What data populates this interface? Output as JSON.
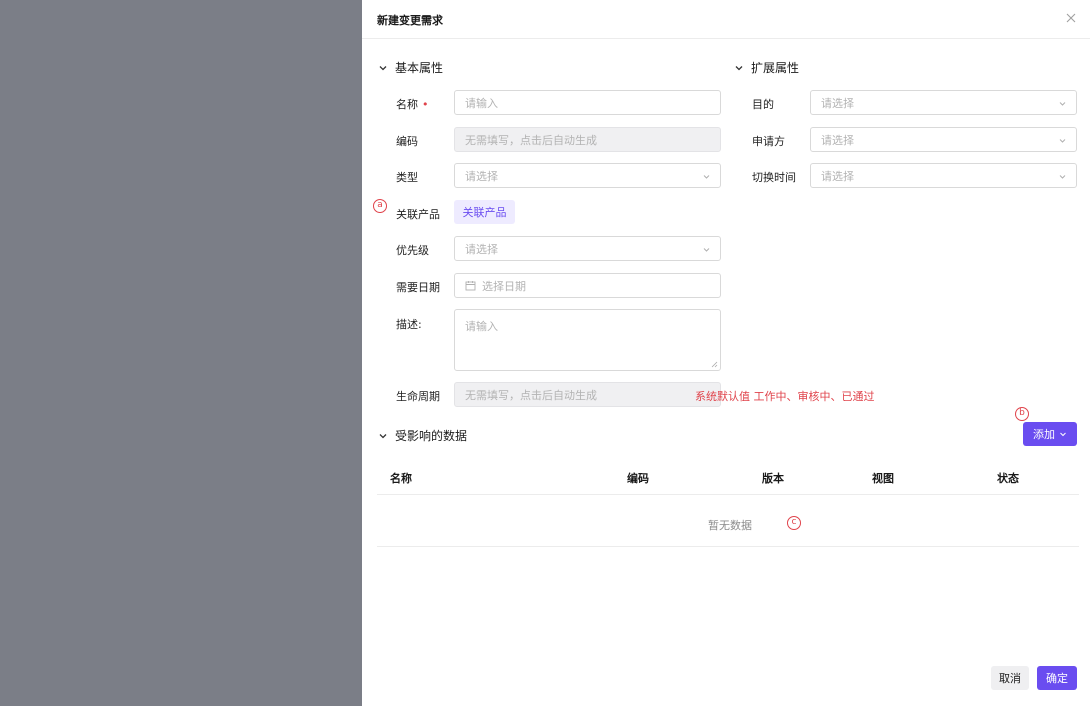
{
  "drawer": {
    "title": "新建变更需求"
  },
  "basic": {
    "section_title": "基本属性",
    "name_label": "名称",
    "name_required": "•",
    "name_placeholder": "请输入",
    "code_label": "编码",
    "code_value": "无需填写，点击后自动生成",
    "type_label": "类型",
    "type_placeholder": "请选择",
    "related_label": "关联产品",
    "related_button": "关联产品",
    "priority_label": "优先级",
    "priority_placeholder": "请选择",
    "date_label": "需要日期",
    "date_placeholder": "选择日期",
    "desc_label": "描述:",
    "desc_placeholder": "请输入",
    "lifecycle_label": "生命周期",
    "lifecycle_value": "无需填写，点击后自动生成",
    "lifecycle_note": "系统默认值 工作中、审核中、已通过"
  },
  "extended": {
    "section_title": "扩展属性",
    "purpose_label": "目的",
    "purpose_placeholder": "请选择",
    "applicant_label": "申请方",
    "applicant_placeholder": "请选择",
    "switch_time_label": "切换时间",
    "switch_time_placeholder": "请选择"
  },
  "affected": {
    "section_title": "受影响的数据",
    "add_button": "添加",
    "columns": [
      "名称",
      "编码",
      "版本",
      "视图",
      "状态"
    ],
    "empty_text": "暂无数据"
  },
  "markers": {
    "a": "a",
    "b": "b",
    "c": "c"
  },
  "footer": {
    "cancel": "取消",
    "confirm": "确定"
  },
  "colors": {
    "accent": "#6a4df0",
    "accent_light": "#eeebff",
    "mask": "#7b7e87",
    "annotation_red": "#e0434b"
  }
}
